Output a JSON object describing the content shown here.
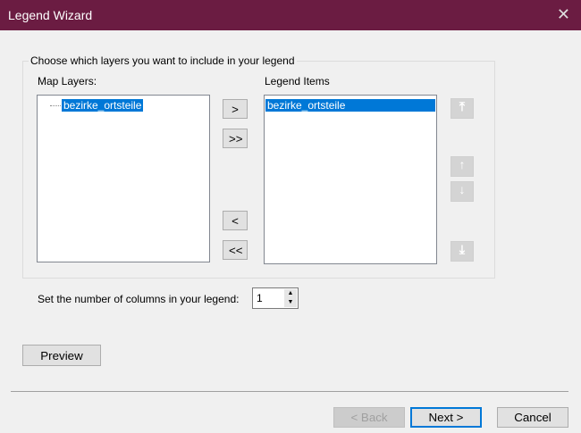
{
  "window": {
    "title": "Legend Wizard"
  },
  "group": {
    "label": "Choose which layers you want to include in your legend"
  },
  "map_layers": {
    "label": "Map Layers:",
    "items": [
      "bezirke_ortsteile"
    ]
  },
  "legend_items": {
    "label": "Legend Items",
    "items": [
      "bezirke_ortsteile"
    ]
  },
  "transfer": {
    "add": ">",
    "add_all": ">>",
    "remove": "<",
    "remove_all": "<<"
  },
  "order": {
    "top": "⤒",
    "up": "↑",
    "down": "↓",
    "bottom": "⤓"
  },
  "columns": {
    "label": "Set the number of columns in your legend:",
    "value": "1"
  },
  "buttons": {
    "preview": "Preview",
    "back": "< Back",
    "next": "Next >",
    "cancel": "Cancel"
  }
}
